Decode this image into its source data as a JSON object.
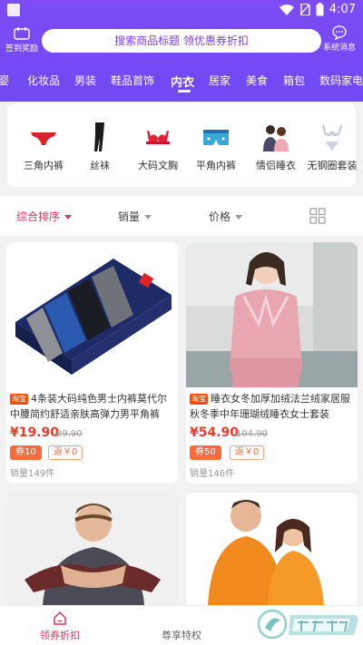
{
  "status": {
    "time": "4:07"
  },
  "header": {
    "sign_label": "签到奖励",
    "search_placeholder": "搜索商品标题 领优惠券折扣",
    "message_label": "系统消息"
  },
  "category_tabs": [
    "婴",
    "化妆品",
    "男装",
    "鞋品首饰",
    "内衣",
    "居家",
    "美食",
    "箱包",
    "数码家电"
  ],
  "active_tab": "内衣",
  "subcategories": [
    {
      "name": "三角内裤",
      "icon": "briefs-icon"
    },
    {
      "name": "丝袜",
      "icon": "stockings-icon"
    },
    {
      "name": "大码文胸",
      "icon": "bra-icon"
    },
    {
      "name": "平角内裤",
      "icon": "boxer-icon"
    },
    {
      "name": "情侣睡衣",
      "icon": "couple-pajamas-icon"
    },
    {
      "name": "无钢圈套装",
      "icon": "bra-set-icon"
    }
  ],
  "sort": {
    "comprehensive": "综合排序",
    "sales": "销量",
    "price": "价格"
  },
  "products": [
    {
      "platform": "淘宝",
      "title": "4条装大码纯色男士内裤莫代尔中腰简约舒适亲肤高弹力男平角裤",
      "price": "¥19.90",
      "original_price": "29.90",
      "coupon": "券10",
      "rebate": "返￥0",
      "sales": "销量149件"
    },
    {
      "platform": "淘宝",
      "title": "睡衣女冬加厚加绒法兰绒家居服秋冬季中年珊瑚绒睡衣女士套装",
      "price": "¥54.90",
      "original_price": "104.90",
      "coupon": "券50",
      "rebate": "返￥0",
      "sales": "销量146件"
    }
  ],
  "bottom_nav": {
    "home": "领券折扣",
    "vip": "尊享特权"
  },
  "colors": {
    "header": "#7549f5",
    "accent": "#e0345f",
    "price": "#f1392b"
  }
}
